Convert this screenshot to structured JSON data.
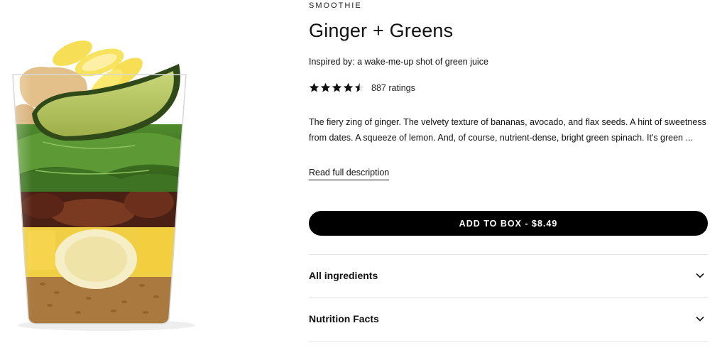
{
  "product": {
    "category": "SMOOTHIE",
    "title": "Ginger + Greens",
    "inspired": "Inspired by: a wake-me-up shot of green juice",
    "rating": 4.5,
    "rating_count": "887 ratings",
    "description": "The fiery zing of ginger. The velvety texture of bananas, avocado, and flax seeds. A hint of sweetness from dates. A squeeze of lemon. And, of course, nutrient-dense, bright green spinach. It's green ...",
    "read_more": "Read full description",
    "add_button": "ADD TO BOX - $8.49"
  },
  "accordions": [
    {
      "label": "All ingredients",
      "icon": "chevron-down-icon"
    },
    {
      "label": "Nutrition Facts",
      "icon": "chevron-down-icon"
    }
  ],
  "colors": {
    "button_bg": "#000000",
    "button_text": "#ffffff",
    "divider": "#e3e3e3",
    "star": "#111111"
  }
}
